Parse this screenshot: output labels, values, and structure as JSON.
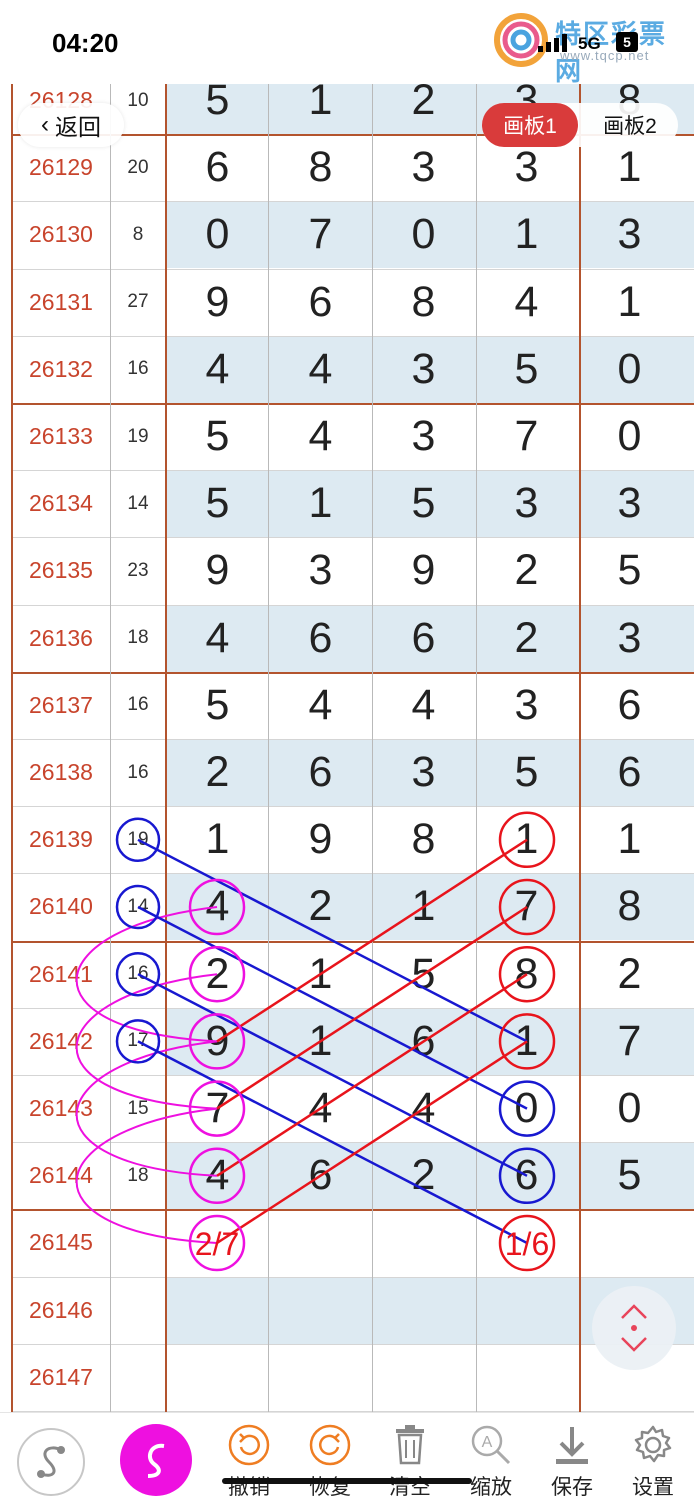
{
  "status_bar": {
    "time": "04:20",
    "network": "5G",
    "battery": "5"
  },
  "watermark": {
    "text": "特区彩票网",
    "url": "www.tqcp.net"
  },
  "nav": {
    "back_label": "返回",
    "tabs": [
      "画板1",
      "画板2"
    ],
    "active_tab": "画板1"
  },
  "table": {
    "rows": [
      {
        "period": "26128",
        "sum": "10",
        "digits": [
          "5",
          "1",
          "2",
          "3",
          "8"
        ]
      },
      {
        "period": "26129",
        "sum": "20",
        "digits": [
          "6",
          "8",
          "3",
          "3",
          "1"
        ]
      },
      {
        "period": "26130",
        "sum": "8",
        "digits": [
          "0",
          "7",
          "0",
          "1",
          "3"
        ]
      },
      {
        "period": "26131",
        "sum": "27",
        "digits": [
          "9",
          "6",
          "8",
          "4",
          "1"
        ]
      },
      {
        "period": "26132",
        "sum": "16",
        "digits": [
          "4",
          "4",
          "3",
          "5",
          "0"
        ]
      },
      {
        "period": "26133",
        "sum": "19",
        "digits": [
          "5",
          "4",
          "3",
          "7",
          "0"
        ]
      },
      {
        "period": "26134",
        "sum": "14",
        "digits": [
          "5",
          "1",
          "5",
          "3",
          "3"
        ]
      },
      {
        "period": "26135",
        "sum": "23",
        "digits": [
          "9",
          "3",
          "9",
          "2",
          "5"
        ]
      },
      {
        "period": "26136",
        "sum": "18",
        "digits": [
          "4",
          "6",
          "6",
          "2",
          "3"
        ]
      },
      {
        "period": "26137",
        "sum": "16",
        "digits": [
          "5",
          "4",
          "4",
          "3",
          "6"
        ]
      },
      {
        "period": "26138",
        "sum": "16",
        "digits": [
          "2",
          "6",
          "3",
          "5",
          "6"
        ]
      },
      {
        "period": "26139",
        "sum": "19",
        "digits": [
          "1",
          "9",
          "8",
          "1",
          "1"
        ]
      },
      {
        "period": "26140",
        "sum": "14",
        "digits": [
          "4",
          "2",
          "1",
          "7",
          "8"
        ]
      },
      {
        "period": "26141",
        "sum": "16",
        "digits": [
          "2",
          "1",
          "5",
          "8",
          "2"
        ]
      },
      {
        "period": "26142",
        "sum": "17",
        "digits": [
          "9",
          "1",
          "6",
          "1",
          "7"
        ]
      },
      {
        "period": "26143",
        "sum": "15",
        "digits": [
          "7",
          "4",
          "4",
          "0",
          "0"
        ]
      },
      {
        "period": "26144",
        "sum": "18",
        "digits": [
          "4",
          "6",
          "2",
          "6",
          "5"
        ]
      },
      {
        "period": "26145",
        "sum": "",
        "digits": [
          "",
          "",
          "",
          "",
          ""
        ]
      },
      {
        "period": "26146",
        "sum": "",
        "digits": [
          "",
          "",
          "",
          "",
          ""
        ]
      },
      {
        "period": "26147",
        "sum": "",
        "digits": [
          "",
          "",
          "",
          "",
          ""
        ]
      }
    ],
    "predictions": {
      "col1": "2/7",
      "col4": "1/6"
    }
  },
  "colors": {
    "period": "#c8442c",
    "accent_red": "#e8141c",
    "blue": "#1818d0",
    "magenta": "#ee10e0",
    "active_tab": "#d93b3b"
  },
  "toolbar": {
    "items": [
      {
        "label": "",
        "icon": "s-curve-icon"
      },
      {
        "label": "",
        "icon": "pen-icon"
      },
      {
        "label": "撤销",
        "icon": "undo-icon"
      },
      {
        "label": "恢复",
        "icon": "redo-icon"
      },
      {
        "label": "清空",
        "icon": "trash-icon"
      },
      {
        "label": "缩放",
        "icon": "zoom-icon"
      },
      {
        "label": "保存",
        "icon": "download-icon"
      },
      {
        "label": "设置",
        "icon": "gear-icon"
      }
    ]
  }
}
